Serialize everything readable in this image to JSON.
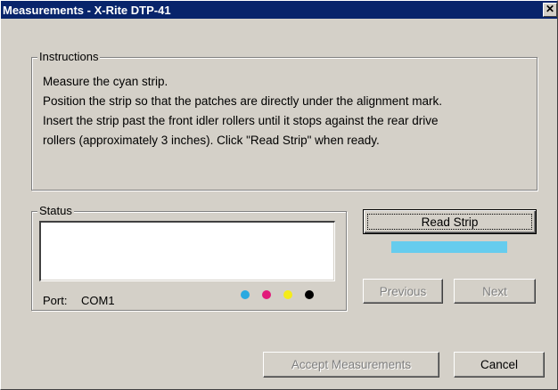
{
  "window": {
    "title": "Measurements - X-Rite DTP-41",
    "close_glyph": "✕"
  },
  "instructions": {
    "label": "Instructions",
    "lines": [
      "Measure the cyan strip.",
      "Position the strip so that the patches are directly under the alignment mark.",
      "Insert the strip past the front idler rollers until it stops against the rear drive",
      "rollers (approximately 3 inches).  Click \"Read Strip\" when ready."
    ]
  },
  "status": {
    "label": "Status",
    "port_label": "Port:",
    "port_value": "COM1",
    "color_dots": [
      "#29a9e0",
      "#e2197a",
      "#f5ec1a",
      "#000000"
    ]
  },
  "buttons": {
    "read_strip": "Read Strip",
    "previous": "Previous",
    "next": "Next",
    "accept": "Accept Measurements",
    "cancel": "Cancel"
  },
  "progress": {
    "color": "#66ccee",
    "fraction": 1.0
  }
}
